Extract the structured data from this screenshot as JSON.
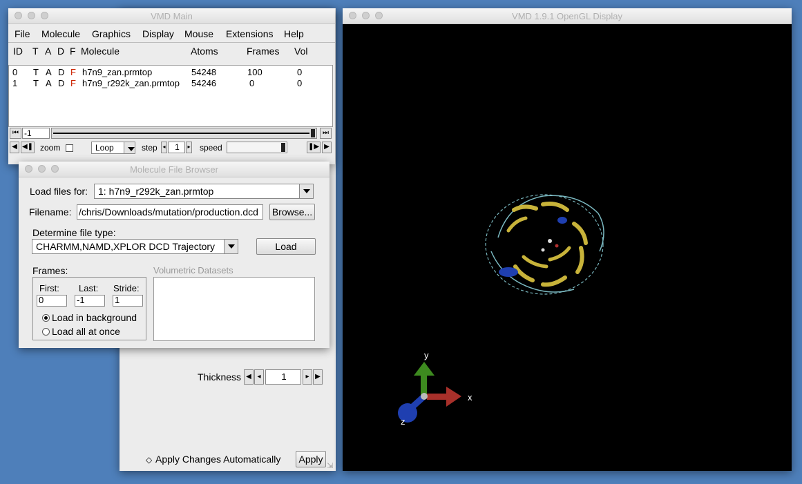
{
  "main_window": {
    "title": "VMD Main",
    "menu": [
      "File",
      "Molecule",
      "Graphics",
      "Display",
      "Mouse",
      "Extensions",
      "Help"
    ],
    "columns": {
      "id": "ID",
      "t": "T",
      "a": "A",
      "d": "D",
      "f": "F",
      "molecule": "Molecule",
      "atoms": "Atoms",
      "frames": "Frames",
      "vol": "Vol"
    },
    "rows": [
      {
        "id": "0",
        "t": "T",
        "a": "A",
        "d": "D",
        "f": "F",
        "molecule": "h7n9_zan.prmtop",
        "atoms": "54248",
        "frames": "100",
        "vol": "0"
      },
      {
        "id": "1",
        "t": "T",
        "a": "A",
        "d": "D",
        "f": "F",
        "molecule": "h7n9_r292k_zan.prmtop",
        "atoms": "54246",
        "frames": "0",
        "vol": "0"
      }
    ],
    "frame_value": "-1",
    "zoom_label": "zoom",
    "loop_mode": "Loop",
    "step_label": "step",
    "step_value": "1",
    "speed_label": "speed"
  },
  "graphics_window": {
    "thickness_label": "Thickness",
    "thickness_value": "1",
    "auto_apply_label": "Apply Changes Automatically",
    "apply_label": "Apply"
  },
  "browser": {
    "title": "Molecule File Browser",
    "load_for_label": "Load files for:",
    "load_for_value": "1: h7n9_r292k_zan.prmtop",
    "filename_label": "Filename:",
    "filename_value": "/chris/Downloads/mutation/production.dcd",
    "browse_label": "Browse...",
    "filetype_label": "Determine file type:",
    "filetype_value": "CHARMM,NAMD,XPLOR DCD Trajectory",
    "load_label": "Load",
    "frames_label": "Frames:",
    "first_label": "First:",
    "first_value": "0",
    "last_label": "Last:",
    "last_value": "-1",
    "stride_label": "Stride:",
    "stride_value": "1",
    "bg_label": "Load in background",
    "all_label": "Load all at once",
    "volumetric_label": "Volumetric Datasets"
  },
  "display": {
    "title": "VMD 1.9.1 OpenGL Display",
    "axis_x": "x",
    "axis_y": "y",
    "axis_z": "z"
  },
  "colors": {
    "flag_f": "#cc2200",
    "axis_x": "#a8302a",
    "axis_y": "#3d8a1f",
    "axis_z": "#1f3fb0",
    "ribbon": "#c8b33a",
    "coil": "#7ab8c0"
  }
}
